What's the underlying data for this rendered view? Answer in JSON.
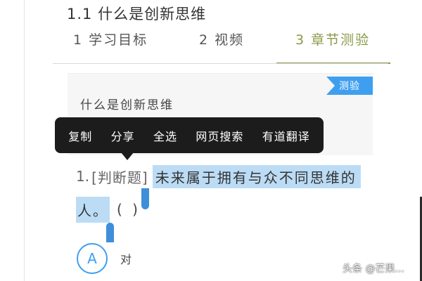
{
  "section": {
    "title": "1.1 什么是创新思维"
  },
  "tabs": [
    {
      "label": "1 学习目标"
    },
    {
      "label": "2 视频"
    },
    {
      "label": "3 章节测验"
    }
  ],
  "quiz": {
    "badge": "测验",
    "title": "什么是创新思维"
  },
  "context_menu": {
    "items": [
      {
        "label": "复制"
      },
      {
        "label": "分享"
      },
      {
        "label": "全选"
      },
      {
        "label": "网页搜索"
      },
      {
        "label": "有道翻译"
      }
    ]
  },
  "question": {
    "number": "1.",
    "type": "[判断题]",
    "text_part1": "未来属于拥有与众不同思维的",
    "text_part2": "人。",
    "paren": "( )"
  },
  "options": [
    {
      "letter": "A",
      "text": "对"
    }
  ],
  "watermark": "头条 @芒果..."
}
